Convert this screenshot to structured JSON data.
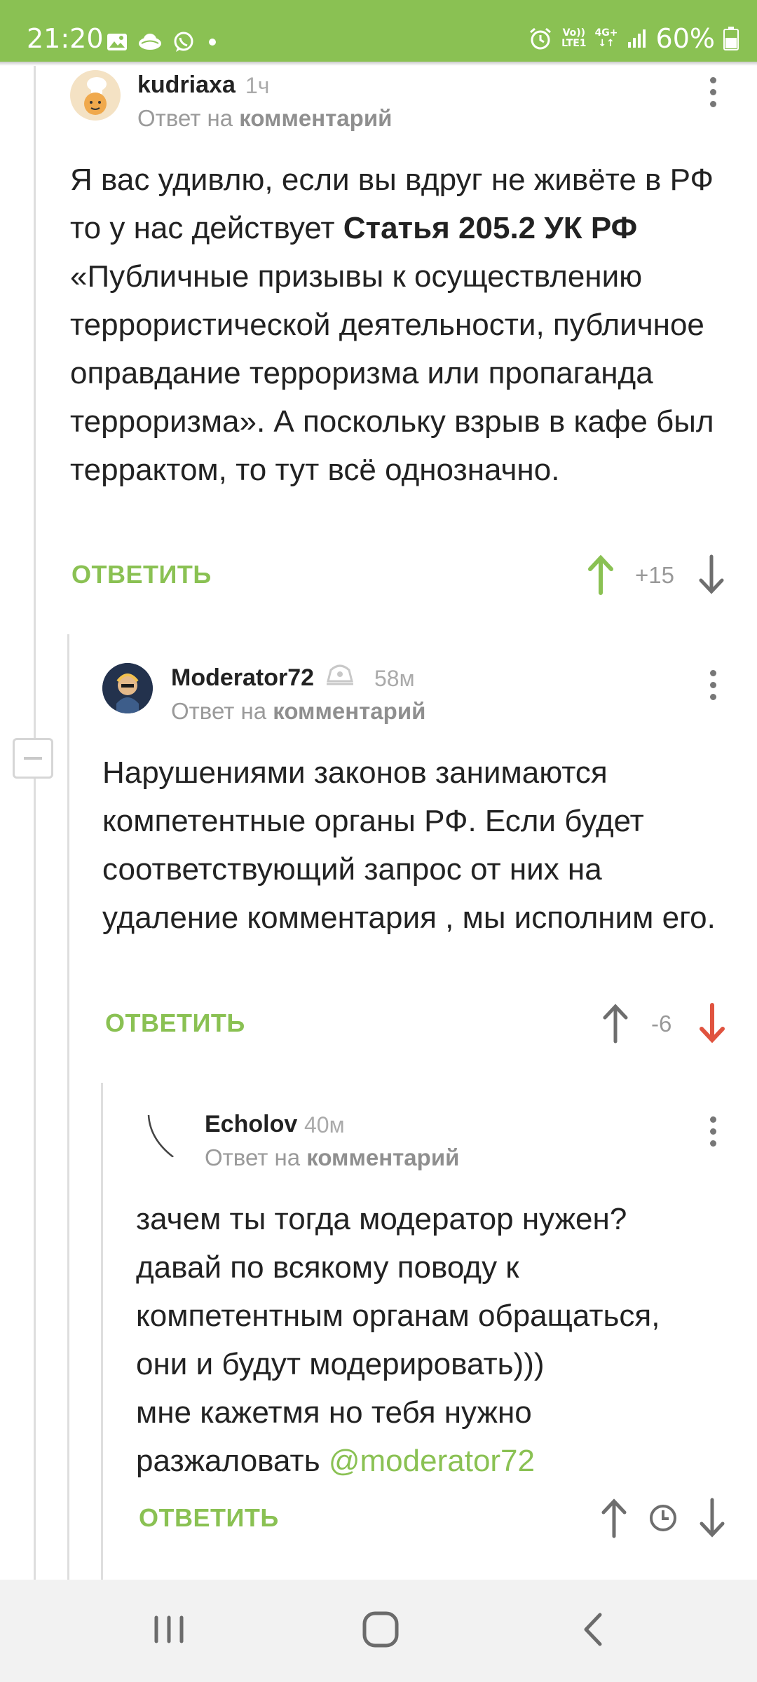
{
  "status_bar": {
    "time": "21:20",
    "battery": "60%",
    "left_icons": [
      "image-icon",
      "cloud-icon",
      "whatsapp-icon",
      "dot-icon"
    ],
    "right_icons": [
      "alarm-icon",
      "volte-icon",
      "data-4g-icon",
      "signal-icon",
      "battery-icon"
    ],
    "volte_line1": "Vo))",
    "volte_line2": "LTE1",
    "net_label": "4G+"
  },
  "comments": [
    {
      "username": "kudriaxa",
      "time": "1ч",
      "reply_prefix": "Ответ на",
      "reply_target": "комментарий",
      "body_parts": [
        "Я вас удивлю, если вы вдруг не живёте в РФ то у нас действует ",
        "Статья 205.2 УК РФ",
        " «Публичные призывы к осуществлению террористической деятельности, публичное оправдание терроризма или пропаганда терроризма». А поскольку взрыв в кафе был террактом, то тут всё однозначно."
      ],
      "reply_label": "ОТВЕТИТЬ",
      "rating": "+15",
      "vote": "up"
    },
    {
      "username": "Moderator72",
      "time": "58м",
      "reply_prefix": "Ответ на",
      "reply_target": "комментарий",
      "body": "Нарушениями законов занимаются компетентные органы РФ. Если будет соответствующий запрос от них на удаление комментария , мы исполним его.",
      "reply_label": "ОТВЕТИТЬ",
      "rating": "-6",
      "vote": "down"
    },
    {
      "username": "Echolov",
      "time": "40м",
      "reply_prefix": "Ответ на",
      "reply_target": "комментарий",
      "body_lines": [
        "зачем ты тогда модератор нужен?",
        "давай по всякому поводу к",
        "компетентным органам обращаться,",
        "они и будут модерировать)))",
        "мне кажетмя но тебя нужно",
        "разжаловать "
      ],
      "mention": "@moderator72",
      "reply_label": "ОТВЕТИТЬ",
      "vote": "none"
    }
  ],
  "colors": {
    "accent_green": "#8ac153",
    "downvote_red": "#e0533f",
    "text": "#222222",
    "muted": "#9a9a9a"
  },
  "nav": [
    "recent-apps-icon",
    "home-icon",
    "back-icon"
  ]
}
